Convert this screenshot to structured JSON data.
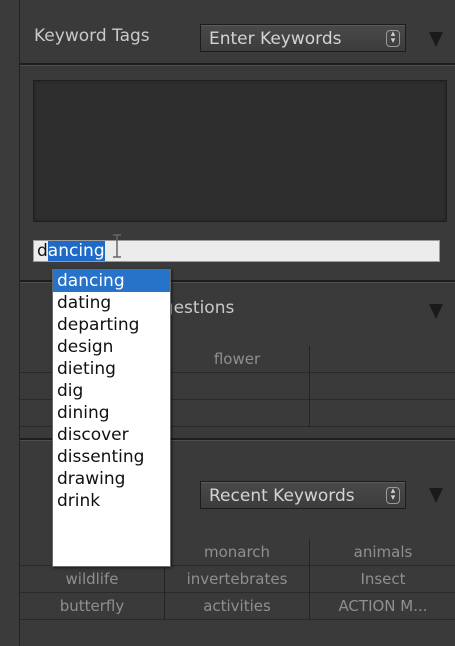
{
  "keyword_tags": {
    "label": "Keyword Tags",
    "mode_select": "Enter Keywords",
    "input_text_plain": "d",
    "input_text_selected": "ancing"
  },
  "autocomplete": {
    "items": [
      "dancing",
      "dating",
      "departing",
      "design",
      "dieting",
      "dig",
      "dining",
      "discover",
      "dissenting",
      "drawing",
      "drink"
    ],
    "selected_index": 0
  },
  "suggestions": {
    "label_visible": "ggestions",
    "rows": [
      [
        "",
        "flower",
        ""
      ],
      [
        "",
        "",
        ""
      ],
      [
        "",
        "",
        ""
      ]
    ]
  },
  "keyword_set": {
    "label_visible": ":",
    "set_select": "Recent Keywords",
    "rows": [
      [
        "",
        "monarch",
        "animals"
      ],
      [
        "wildlife",
        "invertebrates",
        "Insect"
      ],
      [
        "butterfly",
        "activities",
        "ACTION M..."
      ]
    ]
  },
  "colors": {
    "panel_bg": "#3a3a3a",
    "highlight": "#2673c9",
    "text_selection": "#1e6ac8"
  }
}
